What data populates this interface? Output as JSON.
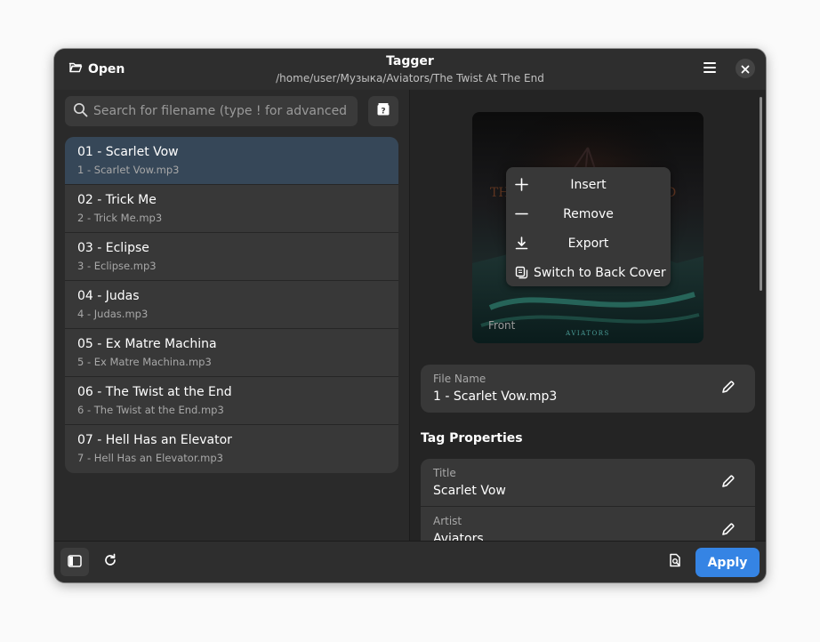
{
  "header": {
    "open_label": "Open",
    "title": "Tagger",
    "subtitle": "/home/user/Музыка/Aviators/The Twist At The End",
    "menu_icon": "hamburger-menu-icon",
    "close_icon": "close-icon"
  },
  "search": {
    "placeholder": "Search for filename (type ! for advanced s…",
    "value": ""
  },
  "files": [
    {
      "title": "01 - Scarlet Vow",
      "filename": "1 - Scarlet Vow.mp3",
      "selected": true
    },
    {
      "title": "02 - Trick Me",
      "filename": "2 - Trick Me.mp3"
    },
    {
      "title": "03 - Eclipse",
      "filename": "3 - Eclipse.mp3"
    },
    {
      "title": "04 - Judas",
      "filename": "4 - Judas.mp3"
    },
    {
      "title": "05 - Ex Matre Machina",
      "filename": "5 - Ex Matre Machina.mp3"
    },
    {
      "title": "06 - The Twist at the End",
      "filename": "6 - The Twist at the End.mp3"
    },
    {
      "title": "07 - Hell Has an Elevator",
      "filename": "7 - Hell Has an Elevator.mp3"
    }
  ],
  "cover": {
    "label": "Front",
    "brand": "AVIATORS",
    "art_text": "THE TWIST AT THE END"
  },
  "cover_menu": [
    {
      "label": "Insert",
      "icon": "plus-icon"
    },
    {
      "label": "Remove",
      "icon": "minus-icon"
    },
    {
      "label": "Export",
      "icon": "download-icon"
    },
    {
      "label": "Switch to Back Cover",
      "icon": "copy-icon"
    }
  ],
  "file_name": {
    "label": "File Name",
    "value": "1 - Scarlet Vow.mp3"
  },
  "tag_properties": {
    "title": "Tag Properties",
    "fields": [
      {
        "label": "Title",
        "value": "Scarlet Vow"
      },
      {
        "label": "Artist",
        "value": "Aviators"
      }
    ]
  },
  "bottom": {
    "apply_label": "Apply"
  },
  "colors": {
    "accent": "#3584e4",
    "selected_row": "#364758",
    "window_bg": "#242424"
  }
}
